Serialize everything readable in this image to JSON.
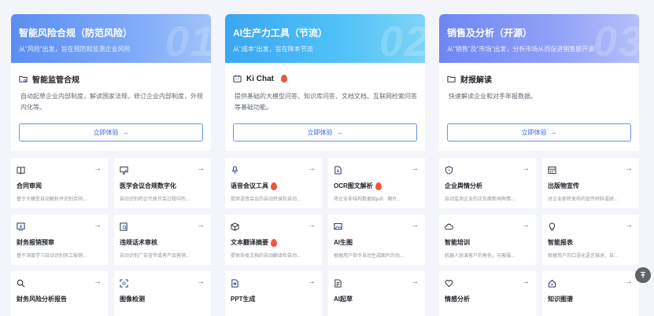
{
  "columns": [
    {
      "header": {
        "title": "智能风险合规（防范风险）",
        "subtitle": "从\"风险\"出发，旨在预防和监测企业风险",
        "number": "01"
      },
      "feature": {
        "title": "智能监管合规",
        "icon": "folder-icon",
        "hot": false,
        "desc": "自动起草企业内部制度，解读国家法规，修订企业内部制度，外规内化等。",
        "button": "立即体验"
      },
      "cards": [
        {
          "name": "合同审阅",
          "icon": "book-icon",
          "hot": false,
          "desc": "基于大模型自动解析并识别合同..."
        },
        {
          "name": "医学会议合规数字化",
          "icon": "monitor-icon",
          "hot": false,
          "desc": "自动识别药企代表开会过程中的..."
        },
        {
          "name": "财务报销预审",
          "icon": "download-icon",
          "hot": false,
          "desc": "基于深度学习自动识别员工报销..."
        },
        {
          "name": "违规话术审核",
          "icon": "audit-icon",
          "hot": false,
          "desc": "自动识别广告宣传或者产品营销..."
        },
        {
          "name": "财务风险分析报告",
          "icon": "search-icon",
          "hot": false,
          "desc": ""
        },
        {
          "name": "图像检测",
          "icon": "scan-icon",
          "hot": false,
          "desc": ""
        }
      ]
    },
    {
      "header": {
        "title": "AI生产力工具（节流）",
        "subtitle": "从\"成本\"出发，旨在降本节流",
        "number": "02"
      },
      "feature": {
        "title": "Ki Chat",
        "icon": "chat-icon",
        "hot": true,
        "desc": "提供基础的大模型问答、知识库问答、文档文档、互联网检索问答等基础功能。",
        "button": "立即体验"
      },
      "cards": [
        {
          "name": "语音会议工具",
          "icon": "mic-icon",
          "hot": true,
          "desc": "提供语音会议的自动转录和自动..."
        },
        {
          "name": "OCR图文解析",
          "icon": "doc-icon",
          "hot": true,
          "desc": "将企业非结构数据如pdf、图片..."
        },
        {
          "name": "文本翻译摘要",
          "icon": "cube-icon",
          "hot": true,
          "desc": "提供各类文档的自动翻译和自动..."
        },
        {
          "name": "AI生图",
          "icon": "image-icon",
          "hot": false,
          "desc": "根据用户指令自动生成图片的功..."
        },
        {
          "name": "PPT生成",
          "icon": "ppt-icon",
          "hot": false,
          "desc": ""
        },
        {
          "name": "AI起草",
          "icon": "draft-icon",
          "hot": false,
          "desc": ""
        }
      ]
    },
    {
      "header": {
        "title": "销售及分析（开源）",
        "subtitle": "从\"销售\"及\"市场\"出发，分析市场从而促进销售额开源",
        "number": "03"
      },
      "feature": {
        "title": "财报解读",
        "icon": "folder-icon",
        "hot": false,
        "desc": "快速解读企业和对手年报数据。",
        "button": "立即体验"
      },
      "cards": [
        {
          "name": "企业舆情分析",
          "icon": "shield-icon",
          "hot": false,
          "desc": "自动监测企业的正负面新闻舆情..."
        },
        {
          "name": "出版物宣传",
          "icon": "calendar-icon",
          "hot": false,
          "desc": "对企业即将发布的宣传材料或研..."
        },
        {
          "name": "智能培训",
          "icon": "cloud-icon",
          "hot": false,
          "desc": "机器人扮演客户的角色，与客服..."
        },
        {
          "name": "智能报表",
          "icon": "bulb-icon",
          "hot": false,
          "desc": "根据用户的口语化语言描述，自..."
        },
        {
          "name": "情感分析",
          "icon": "heart-icon",
          "hot": false,
          "desc": ""
        },
        {
          "name": "知识图谱",
          "icon": "home-icon",
          "hot": false,
          "desc": ""
        }
      ]
    }
  ],
  "colors": {
    "header_gradient_1": "#5a8cf0",
    "header_gradient_2": "#36b4f5",
    "header_gradient_3": "#7b8cf5",
    "accent": "#3366e0",
    "hot": "#f0553f"
  },
  "scroll_top_icon": "arrow-up-icon"
}
